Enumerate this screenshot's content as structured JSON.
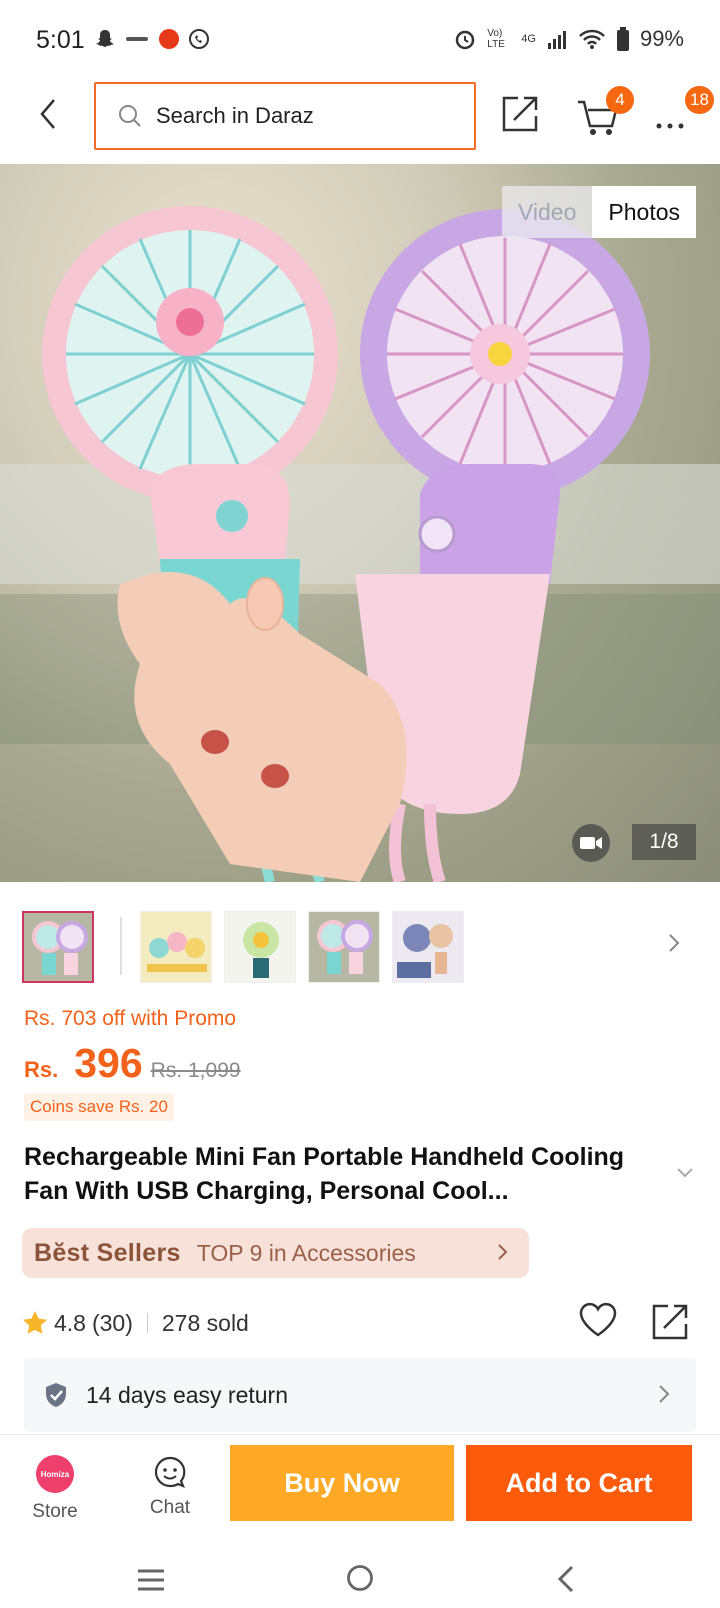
{
  "status_bar": {
    "time": "5:01",
    "network_label_1": "Vo) LTE",
    "network_label_2": "4G",
    "battery": "99%"
  },
  "header": {
    "search_placeholder": "Search in Daraz",
    "cart_badge": "4",
    "more_badge": "18"
  },
  "gallery": {
    "tab_video": "Video",
    "tab_photos": "Photos",
    "counter": "1/8"
  },
  "price": {
    "promo_text": "Rs. 703 off with Promo",
    "currency": "Rs.",
    "current": "396",
    "original": "Rs. 1,099",
    "coins_text": "Coins save Rs. 20"
  },
  "product": {
    "title": "Rechargeable Mini Fan Portable Handheld Cooling Fan With USB Charging, Personal Cool..."
  },
  "best_sellers": {
    "brand": "Bĕst Sellers",
    "rank_text": "TOP 9 in Accessories"
  },
  "rating": {
    "value": "4.8",
    "count": "(30)",
    "sold": "278 sold"
  },
  "returns": {
    "text": "14 days easy return"
  },
  "action_bar": {
    "store_label": "Store",
    "store_logo_text": "Homiza",
    "chat_label": "Chat",
    "buy_now": "Buy Now",
    "add_to_cart": "Add to Cart"
  },
  "colors": {
    "accent_orange": "#f2621b",
    "buy_now": "#fea925",
    "add_to_cart": "#fb5b0b",
    "badge": "#f5680f",
    "best_sellers_bg": "#f8e1d8"
  }
}
